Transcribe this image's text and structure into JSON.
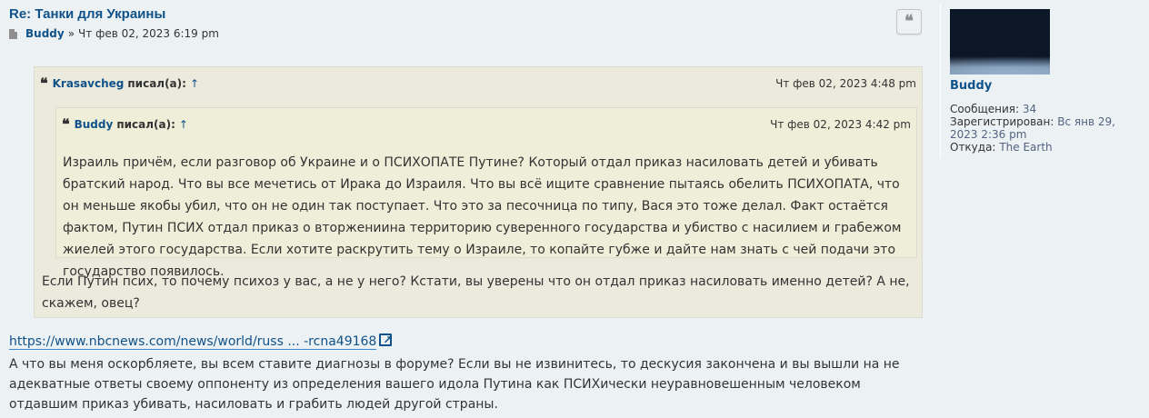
{
  "post": {
    "title": "Re: Танки для Украины",
    "author": "Buddy",
    "separator": "»",
    "date": "Чт фев 02, 2023 6:19 pm"
  },
  "quote_button": {
    "icon": "quote-icon",
    "glyph": "❝"
  },
  "outer_quote": {
    "glyph": "❝",
    "user": "Krasavcheg",
    "wrote": "писал(а):",
    "arrow": "↑",
    "date": "Чт фев 02, 2023 4:48 pm",
    "text": "Если Путин псих, то почему психоз у вас, а не у него? Кстати, вы уверены что он отдал приказ насиловать именно детей? А не, скажем, овец?"
  },
  "inner_quote": {
    "glyph": "❝",
    "user": "Buddy",
    "wrote": "писал(а):",
    "arrow": "↑",
    "date": "Чт фев 02, 2023 4:42 pm",
    "text": "Израиль причём, если разговор об Украине и о ПСИХОПАТЕ Путине? Который отдал приказ насиловать детей и убивать братский народ. Что вы все мечетись от Ирака до Израиля. Что вы всё ищите сравнение пытаясь обелить ПСИХОПАТА, что он меньше якобы убил, что он не один так поступает. Что это за песочница по типу, Вася это тоже делал. Факт остаётся фактом, Путин ПСИХ отдал приказ о вторжениина территорию суверенного государства и убиство с насилием и грабежом жиелей этого государства. Если хотите раскрутить тему о Израиле, то копайте губже и дайте нам знать с чей подачи это государство появилось."
  },
  "link": {
    "text": "https://www.nbcnews.com/news/world/russ ... -rcna49168",
    "icon": "external-link-icon"
  },
  "body_text": "А что вы меня оскорбляете, вы всем ставите диагнозы в форуме? Если вы не извинитесь, то дескусия закончена и вы вышли на не адекватные ответы своему оппоненту из определения вашего идола Путина как ПСИХически неуравновешенным человеком отдавшим приказ убивать, насиловать и грабить людей другой страны.",
  "profile": {
    "name": "Buddy",
    "posts_label": "Сообщения:",
    "posts_value": "34",
    "registered_label": "Зарегистрирован:",
    "registered_value": "Вс янв 29, 2023 2:36 pm",
    "from_label": "Откуда:",
    "from_value": "The Earth"
  }
}
